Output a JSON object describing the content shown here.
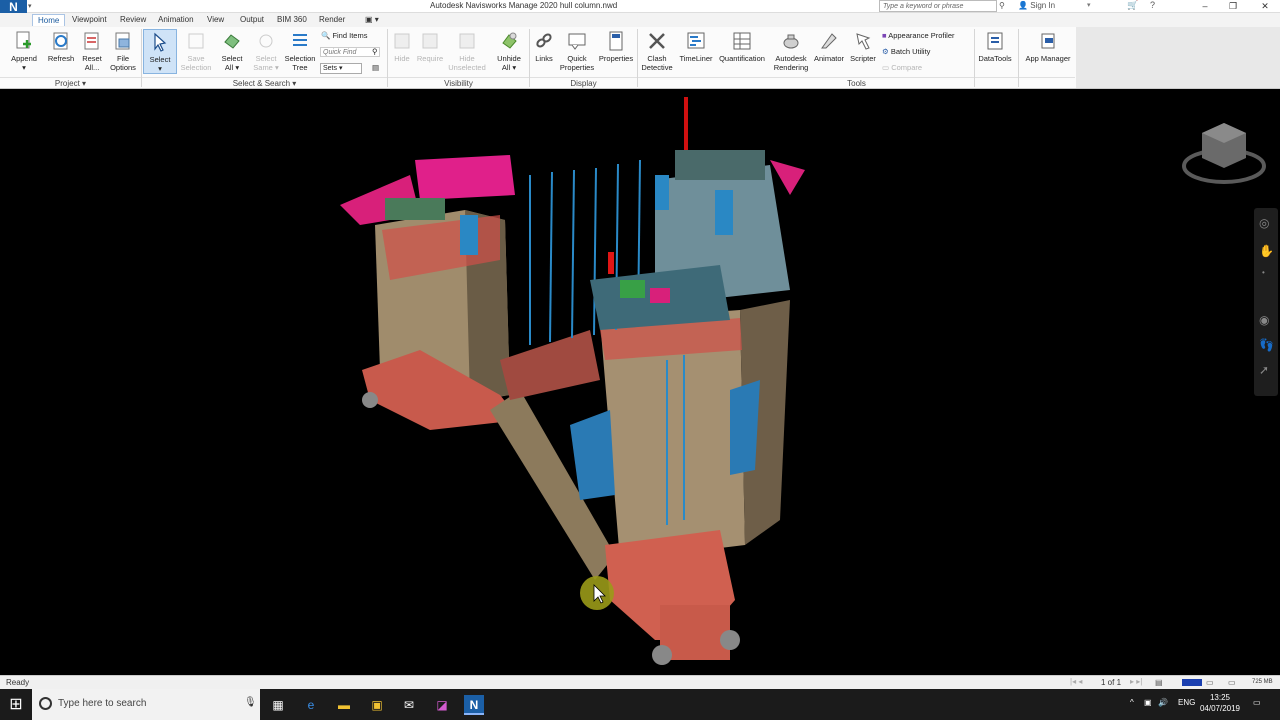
{
  "window": {
    "app_logo": "N",
    "title": "Autodesk Navisworks Manage 2020    hull column.nwd",
    "search_placeholder": "Type a keyword or phrase",
    "signin": "Sign In"
  },
  "tabs": [
    "Home",
    "Viewpoint",
    "Review",
    "Animation",
    "View",
    "Output",
    "BIM 360",
    "Render"
  ],
  "ribbon": {
    "project": {
      "label": "Project ▾",
      "append": "Append",
      "refresh": "Refresh",
      "reset_all": [
        "Reset",
        "All..."
      ],
      "file_options": [
        "File",
        "Options"
      ]
    },
    "select_search": {
      "label": "Select & Search ▾",
      "select": "Select",
      "save_selection": [
        "Save",
        "Selection"
      ],
      "select_all": [
        "Select",
        "All"
      ],
      "select_same": [
        "Select",
        "Same"
      ],
      "selection_tree": [
        "Selection",
        "Tree"
      ],
      "find_items": "Find Items",
      "quick_find": "Quick Find",
      "sets": "Sets"
    },
    "visibility": {
      "label": "Visibility",
      "hide": "Hide",
      "require": "Require",
      "hide_unselected": [
        "Hide",
        "Unselected"
      ],
      "unhide_all": [
        "Unhide",
        "All"
      ]
    },
    "display": {
      "label": "Display",
      "links": "Links",
      "quick_properties": [
        "Quick",
        "Properties"
      ],
      "properties": "Properties"
    },
    "tools": {
      "label": "Tools",
      "clash_detective": [
        "Clash",
        "Detective"
      ],
      "timeliner": "TimeLiner",
      "quantification": "Quantification",
      "autodesk_rendering": [
        "Autodesk",
        "Rendering"
      ],
      "animator": "Animator",
      "scripter": "Scripter",
      "appearance_profiler": "Appearance Profiler",
      "batch_utility": "Batch Utility",
      "compare": "Compare"
    },
    "datatools": "DataTools",
    "app_manager": "App Manager"
  },
  "status": {
    "text": "Ready",
    "page": "1 of 1",
    "memory": "725 MB"
  },
  "taskbar": {
    "search_placeholder": "Type here to search",
    "lang": "ENG",
    "time": "13:25",
    "date": "04/07/2019"
  }
}
